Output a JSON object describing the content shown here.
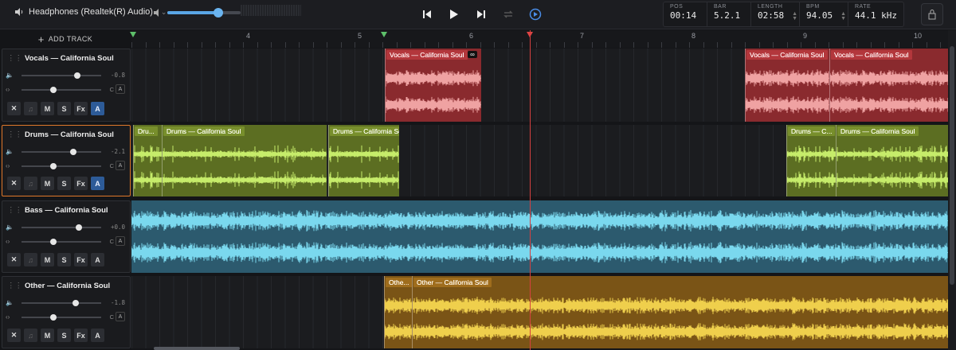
{
  "device": {
    "label": "Headphones (Realtek(R) Audio)",
    "icon": "speaker-icon"
  },
  "volume": {
    "level": 0.7
  },
  "transport": [
    "skip-back-icon",
    "play-icon",
    "skip-forward-icon",
    "loop-icon",
    "follow-icon"
  ],
  "readout": [
    {
      "label": "POS",
      "value": "00:14"
    },
    {
      "label": "BAR",
      "value": "5.2.1"
    },
    {
      "label": "LENGTH",
      "value": "02:58"
    },
    {
      "label": "BPM",
      "value": "94.05"
    },
    {
      "label": "RATE",
      "value": "44.1 kHz"
    }
  ],
  "add_track": "ADD TRACK",
  "ruler": {
    "bars": [
      "4",
      "5",
      "6",
      "7",
      "8",
      "9",
      "10"
    ]
  },
  "buttons": {
    "mute": "M",
    "solo": "S",
    "fx": "Fx",
    "auto": "A",
    "pan_center": "C"
  },
  "colors": {
    "vocals": "#8a2a2e",
    "drums": "#5c6e22",
    "bass": "#2c5a6e",
    "other": "#7a5416",
    "selected": "#e0782a",
    "playhead": "#d64040",
    "accent": "#4a8de8"
  },
  "tracks": [
    {
      "name": "Vocals — California Soul",
      "volume_db": "-0.8",
      "volume": 0.7,
      "pan": 0.4,
      "auto_active": true,
      "clips": [
        {
          "label": "Vocals — California Soul",
          "looped": true
        },
        {
          "label": "Vocals — California Soul"
        },
        {
          "label": "Vocals — California Soul"
        }
      ]
    },
    {
      "name": "Drums — California Soul",
      "volume_db": "-2.1",
      "volume": 0.65,
      "pan": 0.4,
      "auto_active": true,
      "selected": true,
      "clips": [
        {
          "label": "Dru..."
        },
        {
          "label": "Drums — California Soul"
        },
        {
          "label": "Drums — California Soul"
        },
        {
          "label": "Drums — C..."
        },
        {
          "label": "Drums — California Soul"
        }
      ]
    },
    {
      "name": "Bass — California Soul",
      "volume_db": "+0.0",
      "volume": 0.72,
      "pan": 0.4,
      "auto_active": false,
      "clips": []
    },
    {
      "name": "Other — California Soul",
      "volume_db": "-1.8",
      "volume": 0.68,
      "pan": 0.4,
      "auto_active": false,
      "clips": [
        {
          "label": "Othe..."
        },
        {
          "label": "Other — California Soul"
        }
      ]
    }
  ]
}
